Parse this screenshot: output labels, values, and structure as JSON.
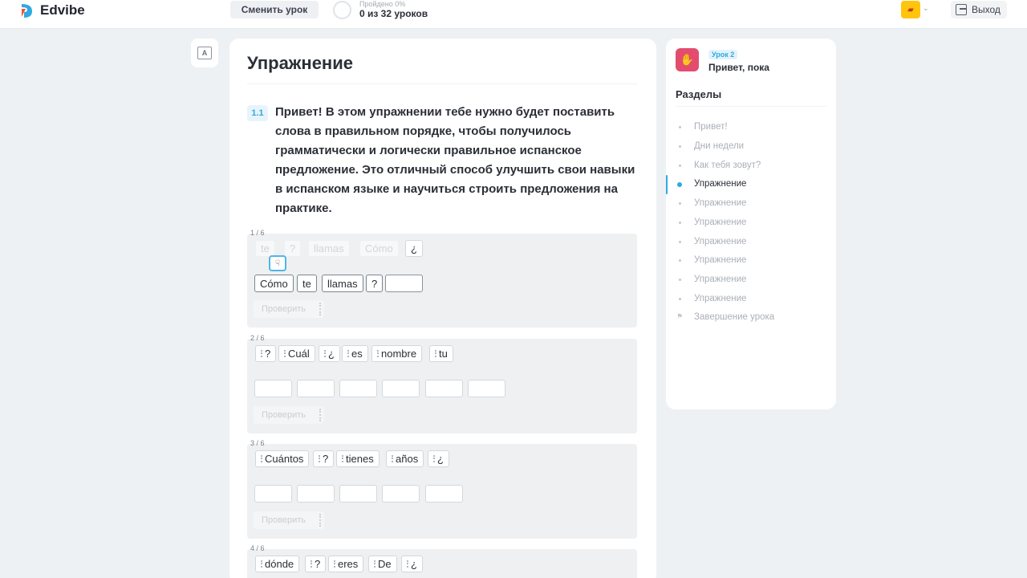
{
  "header": {
    "brand": "Edvibe",
    "change_lesson": "Сменить урок",
    "progress_label": "Пройдено 0%",
    "progress_count": "0 из 32 уроков",
    "exit": "Выход",
    "brand_color": "#2fa9e4"
  },
  "main": {
    "title": "Упражнение",
    "task_number": "1.1",
    "task_text": "Привет! В этом упражнении тебе нужно будет поставить слова в правильном порядке, чтобы получилось грамматически и логически правильное испанское предложение. Это отличный способ улучшить свои навыки в испанском языке и научиться строить предложения на практике.",
    "check_label": "Проверить",
    "exercises": [
      {
        "counter": "1 / 6",
        "bank": [
          "te",
          "?",
          "llamas",
          "Cómo",
          "¿"
        ],
        "answer": [
          "Cómo",
          "te",
          "llamas",
          "?"
        ]
      },
      {
        "counter": "2 / 6",
        "bank": [
          "?",
          "Cuál",
          "¿",
          "es",
          "nombre",
          "tu"
        ]
      },
      {
        "counter": "3 / 6",
        "bank": [
          "Cuántos",
          "?",
          "tienes",
          "años",
          "¿"
        ]
      },
      {
        "counter": "4 / 6",
        "bank": [
          "dónde",
          "?",
          "eres",
          "De",
          "¿"
        ]
      }
    ]
  },
  "sidebar": {
    "lesson_tag": "Урок 2",
    "lesson_name": "Привет, пока",
    "sections_title": "Разделы",
    "items": [
      "Привет!",
      "Дни недели",
      "Как тебя зовут?",
      "Упражнение",
      "Упражнение",
      "Упражнение",
      "Упражнение",
      "Упражнение",
      "Упражнение",
      "Упражнение",
      "Завершение урока"
    ],
    "current_index": 3
  }
}
